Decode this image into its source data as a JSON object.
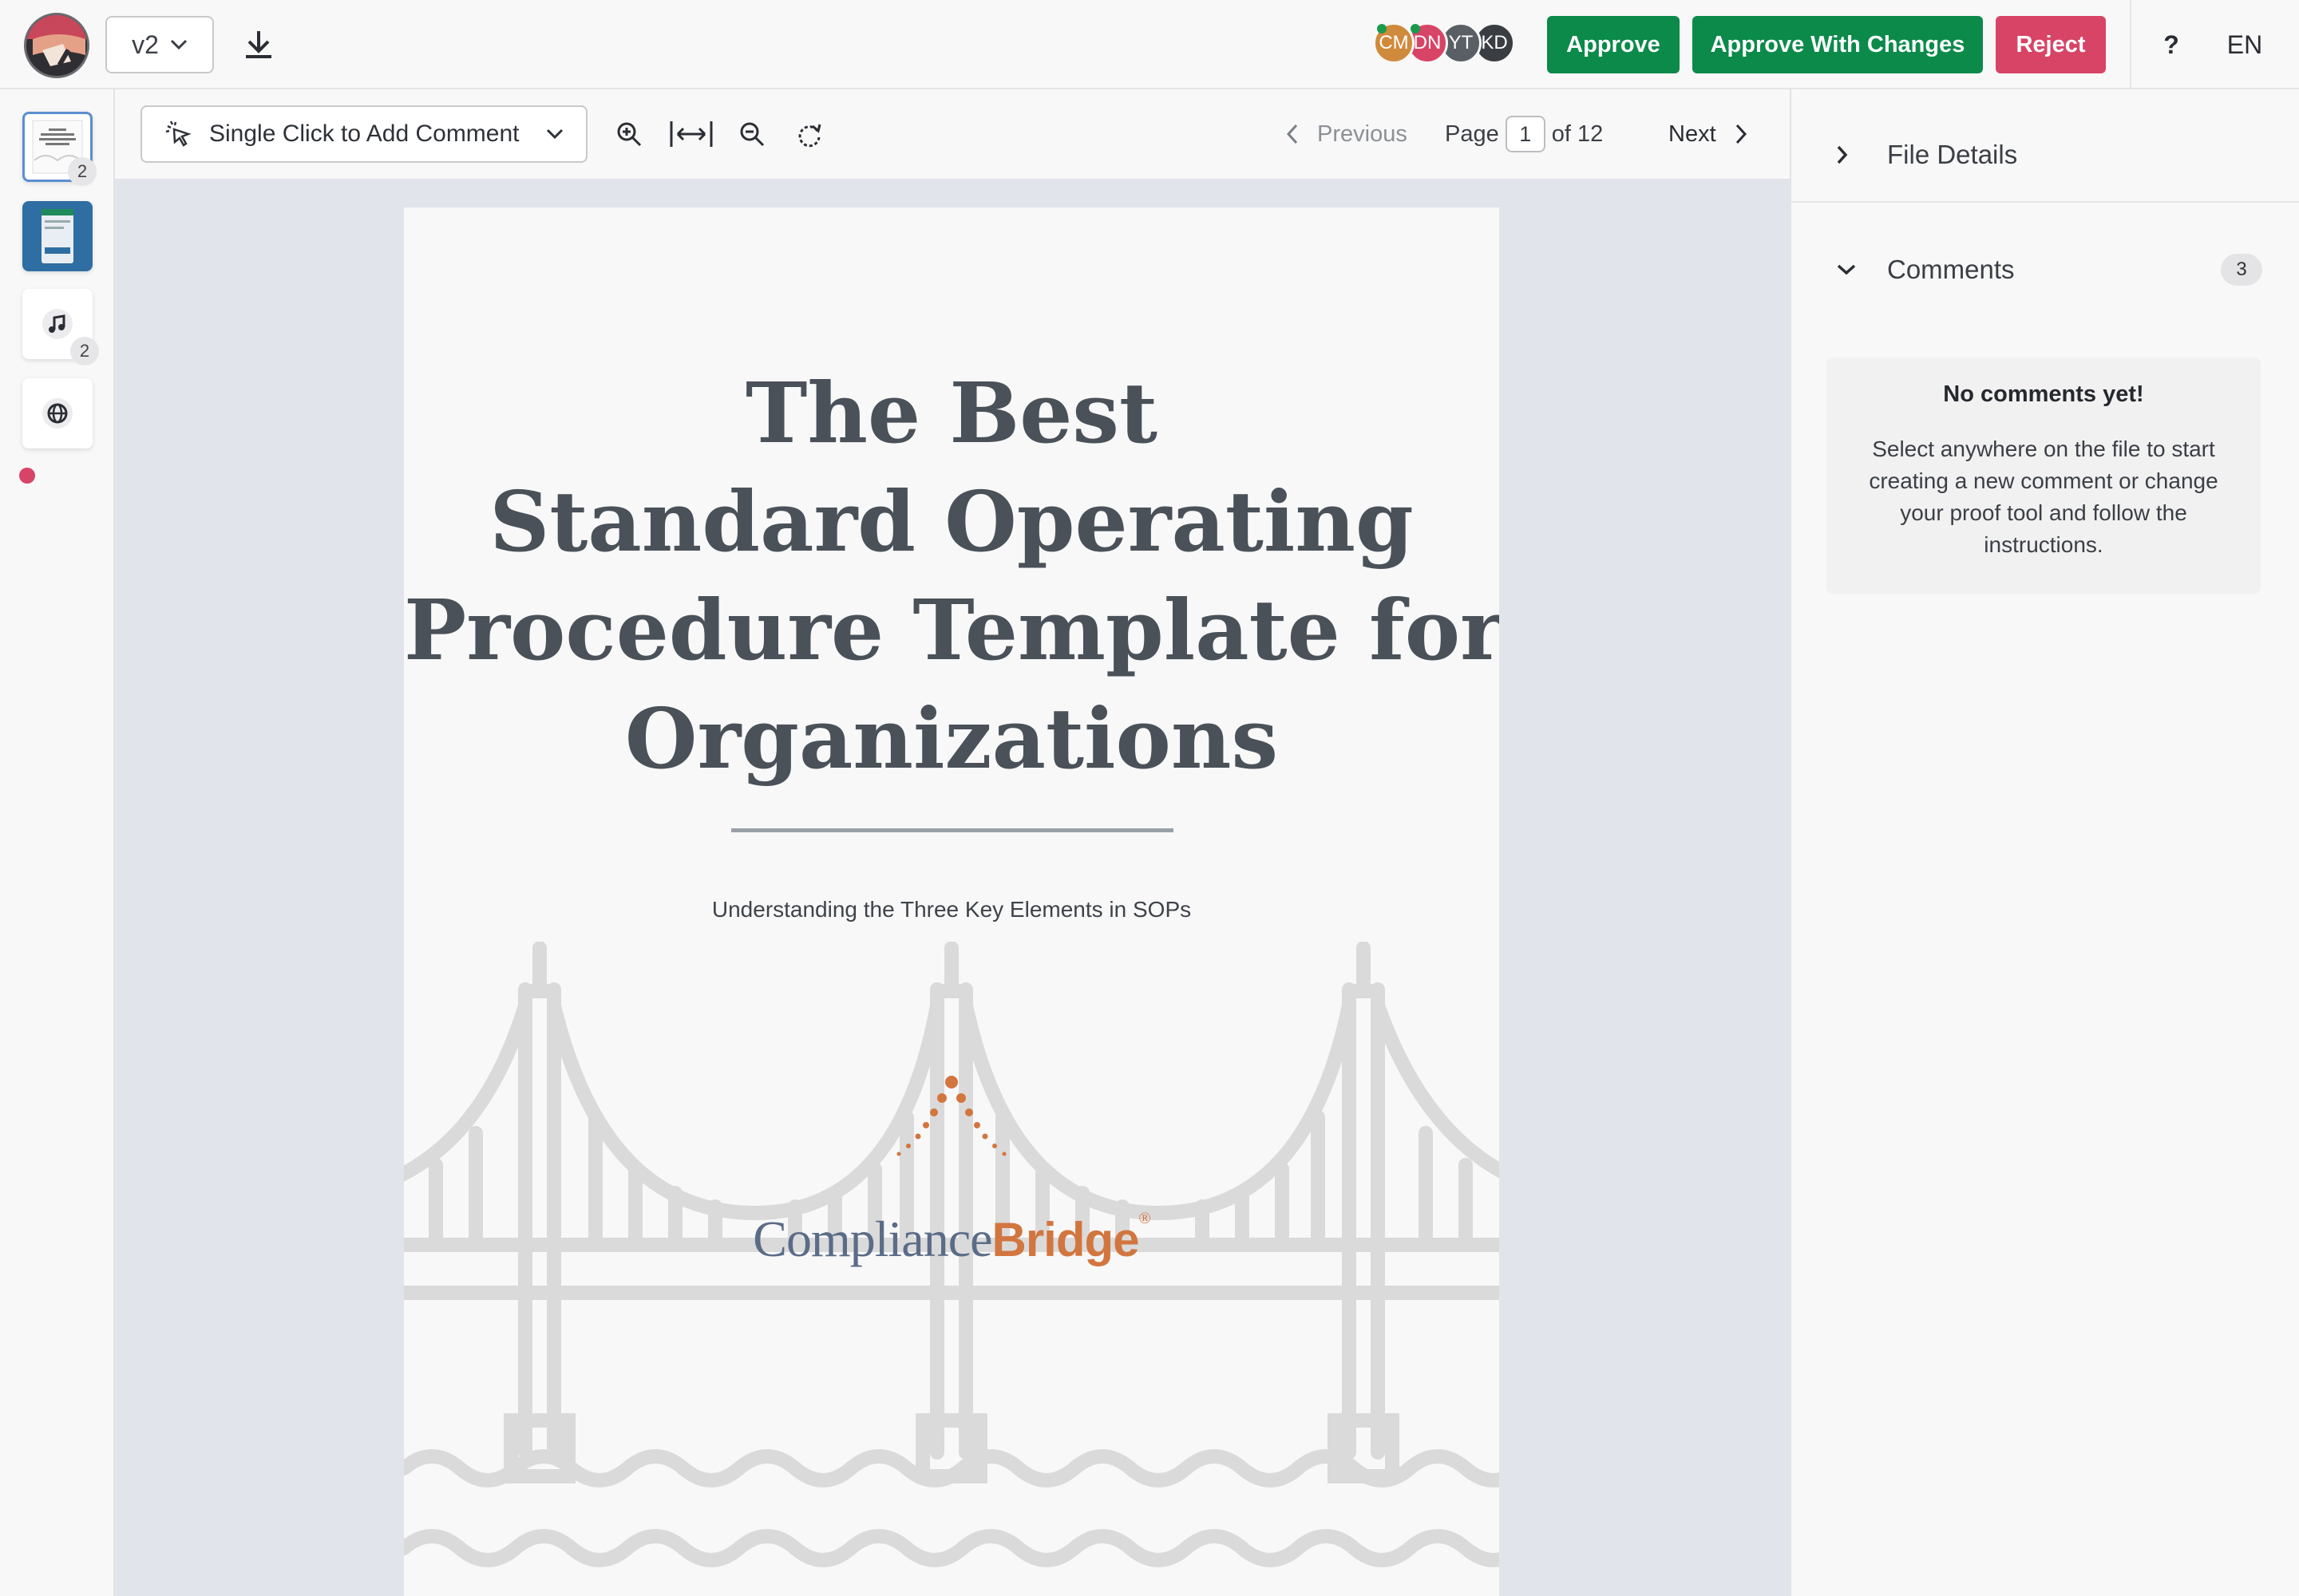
{
  "header": {
    "version_label": "v2",
    "avatars": [
      {
        "initials": "CM",
        "color": "#d08a3c",
        "online": true
      },
      {
        "initials": "DN",
        "color": "#d84466",
        "online": true
      },
      {
        "initials": "YT",
        "color": "#5a5f66",
        "online": false
      },
      {
        "initials": "KD",
        "color": "#3a3d42",
        "online": false
      }
    ],
    "approve_label": "Approve",
    "approve_changes_label": "Approve With Changes",
    "reject_label": "Reject",
    "help_label": "?",
    "language_label": "EN"
  },
  "thumbnails": [
    {
      "kind": "document",
      "count": "2",
      "active": true
    },
    {
      "kind": "image",
      "count": "",
      "active": false
    },
    {
      "kind": "audio",
      "count": "2",
      "active": false
    },
    {
      "kind": "web",
      "count": "",
      "active": false
    }
  ],
  "toolbar": {
    "comment_mode_label": "Single Click to Add Comment",
    "previous_label": "Previous",
    "page_label": "Page",
    "page_current": "1",
    "page_total_label": "of 12",
    "next_label": "Next"
  },
  "document": {
    "title_lines": [
      "The Best",
      "Standard Operating",
      "Procedure Template for",
      "Organizations"
    ],
    "subtitle": "Understanding the Three Key Elements in SOPs",
    "brand_part1": "Compliance",
    "brand_part2": "Bridge",
    "brand_mark": "®"
  },
  "panel": {
    "file_details_label": "File Details",
    "comments_label": "Comments",
    "comments_count": "3",
    "empty_title": "No comments yet!",
    "empty_text": "Select anywhere on the file to start creating a new comment or change your proof tool and follow the instructions."
  },
  "colors": {
    "approve": "#0b8a4a",
    "reject": "#d84466",
    "accent_orange": "#d2763f",
    "viewer_bg": "#e1e4ea"
  }
}
